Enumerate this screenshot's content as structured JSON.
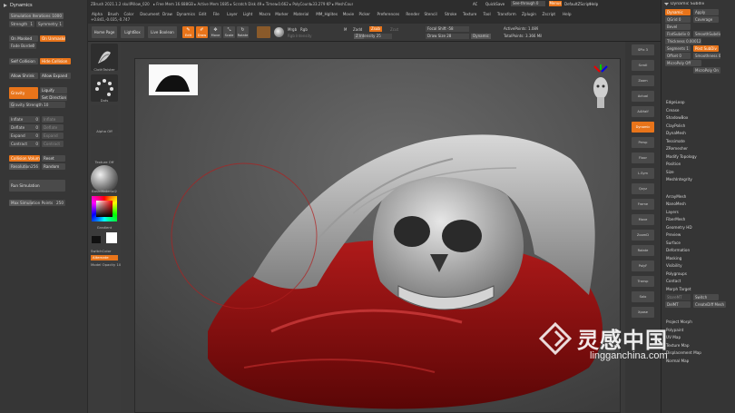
{
  "left_panel": {
    "header": "Dynamics",
    "simulation_iterations": {
      "label": "Simulation Iterations",
      "value": "1000",
      "fill": 1.0
    },
    "strength": {
      "label": "Strength",
      "value": "1"
    },
    "symmetry": {
      "label": "Symmetry",
      "value": "1"
    },
    "on_masked": "On Masked",
    "on_unmasked": "On Unmasked",
    "fade_border": {
      "label": "Fade Border",
      "value": "0"
    },
    "self_collision": "Self Collision",
    "hide_collision": "Hide Collision",
    "allow_shrink": "Allow Shrink",
    "allow_expand": "Allow Expand",
    "gravity": "Gravity",
    "liquify": "Liquify",
    "set_direction": "Set Direction",
    "gravity_strength": {
      "label": "Gravity Strength",
      "value": "10"
    },
    "inflate": {
      "label": "Inflate",
      "value": "0",
      "btn": "Inflate"
    },
    "deflate": {
      "label": "Deflate",
      "value": "0",
      "btn": "Deflate"
    },
    "expand": {
      "label": "Expand",
      "value": "0",
      "btn": "Expand"
    },
    "contract": {
      "label": "Contract",
      "value": "0",
      "btn": "Contract"
    },
    "collision_volume": "Collision Volume",
    "reset": "Reset",
    "resolution": {
      "label": "Resolution",
      "value": "256"
    },
    "random": "Random",
    "run_simulation": "Run Simulation",
    "max_sim_points": {
      "label": "Max Simulation Points",
      "value": "250"
    }
  },
  "top": {
    "title": "ZBrush 2021.1.2 skullPillow_020",
    "status": "▸ Free Mem 16.688GB ▸ Active Mem 1685 ▸ Scratch Disk 49 ▸ Timer▸0.662 ▸ PolyCount▸33.279 KP ▸ MeshCount▸1",
    "coords": "+0.841,-0.035,-0.747",
    "ac": "AC",
    "quicksave": "QuickSave",
    "see_through": {
      "label": "See-through",
      "value": "0"
    },
    "menus_btn": "Menus",
    "default_zscript": "DefaultZScript",
    "help": "Help",
    "menus": [
      "Alpha",
      "Brush",
      "Color",
      "Document",
      "Draw",
      "Dynamics",
      "Edit",
      "File",
      "Layer",
      "Light",
      "Macro",
      "Marker",
      "Material",
      "MM_Hglites",
      "Movie",
      "Picker",
      "Preferences",
      "Render",
      "Stencil",
      "Stroke",
      "Texture",
      "Tool",
      "Transform",
      "Zplugin",
      "Zscript",
      "Help"
    ]
  },
  "toolbar": {
    "home_page": "Home Page",
    "lightbox": "LightBox",
    "live_boolean": "Live Boolean",
    "edit": "Edit",
    "draw": "Draw",
    "move": "Move",
    "scale": "Scale",
    "rotate": "Rotate",
    "mrgb": "Mrgb",
    "rgb": "Rgb",
    "m": "M",
    "zadd": "Zadd",
    "zsub": "Zsub",
    "zcut": "Zcut",
    "rgb_intensity": "Rgb Intensity",
    "z_intensity": {
      "label": "Z Intensity",
      "value": "25"
    },
    "focal_shift": {
      "label": "Focal Shift",
      "value": "-58"
    },
    "draw_size": {
      "label": "Draw Size",
      "value": "28"
    },
    "dynamic": "Dynamic",
    "active_points": {
      "label": "ActivePoints:",
      "value": "1.089"
    },
    "total_points": {
      "label": "TotalPoints:",
      "value": "3.366 Mil"
    }
  },
  "shelf": {
    "brush": "ClothTwister",
    "stroke": "Dots",
    "alpha": "Alpha Off",
    "texture": "Texture Off",
    "material": "BasicMaterial2",
    "gradient": "Gradient",
    "switch_color": "SwitchColor",
    "alternate": "Alternate",
    "model_opacity": {
      "label": "Model Opacity",
      "value": "100"
    }
  },
  "right_tools": [
    "SPix 3",
    "Scroll",
    "Zoom",
    "Actual",
    "AAHalf",
    "Dynamic",
    "Persp",
    "Floor",
    "L.Sym",
    "Qxyz",
    "Frame",
    "Move",
    "ZoomD",
    "Rotate",
    "PolyF",
    "Transp",
    "Solo",
    "Xpose"
  ],
  "right_panel": {
    "header": "Dynamic Subdiv",
    "dynamic": "Dynamic",
    "apply": "Apply",
    "qgrid": {
      "label": "QGrid",
      "value": "0"
    },
    "coverage": "Coverage",
    "bevel": "Bevel",
    "flat_subdiv": {
      "label": "FlatSubdiv",
      "value": "0"
    },
    "smooth_subdiv": "SmoothSubdiv",
    "thickness": {
      "label": "Thickness",
      "value": "0.00012"
    },
    "segments": {
      "label": "Segments",
      "value": "1"
    },
    "post_subdiv": "Post SubDiv",
    "offset": {
      "label": "Offset",
      "value": "0"
    },
    "smoothness": {
      "label": "Smoothness",
      "value": "0"
    },
    "micro_poly": "MicroPoly Off",
    "micro_poly_on": "MicroPoly On",
    "edge_loop": "EdgeLoop",
    "crease": "Crease",
    "shadow_box": "ShadowBox",
    "clay_polish": "ClayPolish",
    "dyna_mesh": "DynaMesh",
    "tessimate": "Tessimate",
    "zremesher": "ZRemesher",
    "modify_topology": "Modify Topology",
    "position": "Position",
    "size": "Size",
    "mesh_integrity": "MeshIntegrity",
    "array_mesh": "ArrayMesh",
    "nano_mesh": "NanoMesh",
    "layers": "Layers",
    "fiber_mesh": "FiberMesh",
    "geometry_hd": "Geometry HD",
    "preview": "Preview",
    "surface": "Surface",
    "deformation": "Deformation",
    "masking": "Masking",
    "visibility": "Visibility",
    "polygroups": "Polygroups",
    "contact": "Contact",
    "morph_target": "Morph Target",
    "store_mt": "StoreMT",
    "switch": "Switch",
    "del_mt": "DelMT",
    "create_diff_mesh": "CreateDiff Mesh",
    "project_morph": "Project Morph",
    "polypaint": "Polypaint",
    "uv_map": "UV Map",
    "texture_map": "Texture Map",
    "displacement_map": "Displacement Map",
    "normal_map": "Normal Map"
  },
  "watermark": {
    "cn": "灵感中国",
    "url": "lingganchina.com"
  },
  "colors": {
    "accent": "#e8741a",
    "panel": "#363636",
    "canvas": "#555555"
  }
}
